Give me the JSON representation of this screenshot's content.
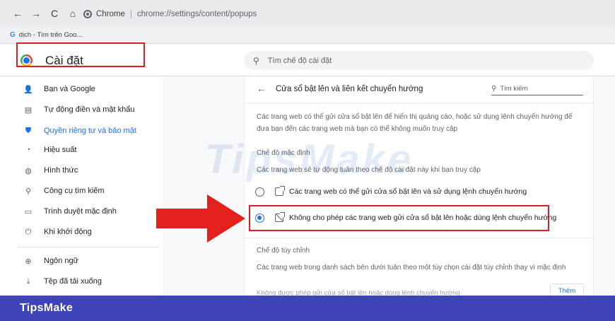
{
  "browser": {
    "chrome_label": "Chrome",
    "url": "chrome://settings/content/popups",
    "bookmark": {
      "icon": "G",
      "label": "dịch - Tìm trên Goo..."
    },
    "nav_icons": {
      "back": "←",
      "forward": "→",
      "reload": "C",
      "home": "⌂"
    }
  },
  "settings": {
    "title": "Cài đặt",
    "search_placeholder": "Tìm chế độ cài đặt",
    "search_icon": "⚲"
  },
  "sidebar": {
    "items": [
      {
        "label": "Bạn và Google",
        "icon": "person-icon",
        "glyph": "👤"
      },
      {
        "label": "Tự động điền và mật khẩu",
        "icon": "clipboard-icon",
        "glyph": "▤"
      },
      {
        "label": "Quyền riêng tư và bảo mật",
        "icon": "shield-icon",
        "glyph": "⛊"
      },
      {
        "label": "Hiệu suất",
        "icon": "speedometer-icon",
        "glyph": "◔"
      },
      {
        "label": "Hình thức",
        "icon": "palette-icon",
        "glyph": "◍"
      },
      {
        "label": "Công cụ tìm kiếm",
        "icon": "search-icon",
        "glyph": "⚲"
      },
      {
        "label": "Trình duyệt mặc định",
        "icon": "browser-icon",
        "glyph": "▭"
      },
      {
        "label": "Khi khởi động",
        "icon": "power-icon",
        "glyph": "⏻"
      },
      {
        "label": "Ngôn ngữ",
        "icon": "globe-icon",
        "glyph": "⊕"
      },
      {
        "label": "Tệp đã tải xuống",
        "icon": "download-icon",
        "glyph": "⤓"
      }
    ],
    "active_item": "Quyền riêng tư và bảo mật"
  },
  "page": {
    "back_icon": "←",
    "title": "Cửa sổ bật lên và liên kết chuyển hướng",
    "search_placeholder": "Tìm kiếm",
    "search_icon": "⚲",
    "description": "Các trang web có thể gửi cửa sổ bật lên để hiển thị quảng cáo, hoặc sử dụng lệnh chuyển hướng để đưa bạn đến các trang web mà bạn có thể không muốn truy cập",
    "default_section": {
      "title": "Chế độ mặc định",
      "description": "Các trang web sẽ tự động tuân theo chế độ cài đặt này khi bạn truy cập",
      "options": [
        {
          "label": "Các trang web có thể gửi cửa sổ bật lên và sử dụng lệnh chuyển hướng",
          "selected": false,
          "icon": "popup-allowed-icon"
        },
        {
          "label": "Không cho phép các trang web gửi cửa sổ bật lên hoặc dùng lệnh chuyển hướng",
          "selected": true,
          "icon": "popup-blocked-icon"
        }
      ]
    },
    "custom_section": {
      "title": "Chế độ tùy chỉnh",
      "description": "Các trang web trong danh sách bên dưới tuân theo một tùy chọn cài đặt tùy chỉnh thay vì mặc định",
      "faded_row": "Không được phép gửi cửa sổ bật lên hoặc dùng lệnh chuyển hướng",
      "add_button": "Thêm"
    }
  },
  "overlay": {
    "watermark": "TipsMake",
    "footer_brand": "TipsMake",
    "highlight_color": "#d61f26",
    "footer_color": "#3f43b8"
  }
}
